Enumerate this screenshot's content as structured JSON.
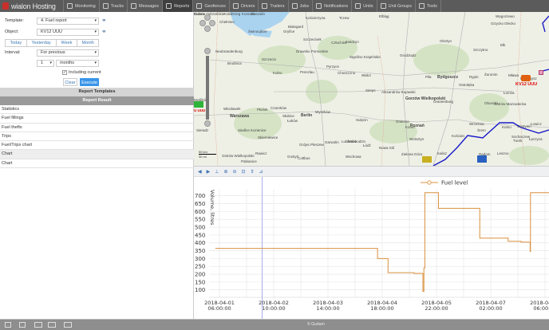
{
  "app": {
    "logo": "wialon Hosting"
  },
  "nav": [
    {
      "label": "Monitoring",
      "icon": "globe-icon"
    },
    {
      "label": "Tracks",
      "icon": "tracks-icon"
    },
    {
      "label": "Messages",
      "icon": "messages-icon"
    },
    {
      "label": "Reports",
      "icon": "reports-icon",
      "active": true
    },
    {
      "label": "Geofences",
      "icon": "geofences-icon"
    },
    {
      "label": "Drivers",
      "icon": "drivers-icon"
    },
    {
      "label": "Trailers",
      "icon": "trailers-icon"
    },
    {
      "label": "Jobs",
      "icon": "jobs-icon"
    },
    {
      "label": "Notifications",
      "icon": "notifications-icon"
    },
    {
      "label": "Units",
      "icon": "units-icon"
    },
    {
      "label": "Unit Groups",
      "icon": "unit-groups-icon"
    },
    {
      "label": "Tools",
      "icon": "tools-icon"
    }
  ],
  "form": {
    "template_label": "Template:",
    "template_value": "4. Fuel report",
    "object_label": "Object:",
    "object_value": "KV12 UUU",
    "quick": [
      "Today",
      "Yesterday",
      "Week",
      "Month"
    ],
    "interval_label": "Interval:",
    "interval_value": "For previous",
    "count_value": "1",
    "unit_value": "months",
    "including_current": "Including current",
    "including_checked": true,
    "clear": "Clear",
    "execute": "Execute"
  },
  "panels": {
    "templates": "Report Templates",
    "result": "Report Result"
  },
  "results": [
    {
      "label": "Statistics"
    },
    {
      "label": "Fuel fillings"
    },
    {
      "label": "Fuel thefts"
    },
    {
      "label": "Trips"
    },
    {
      "label": "Fuel/Trips chart"
    },
    {
      "label": "Chart",
      "selected": true
    },
    {
      "label": "Chart"
    }
  ],
  "map": {
    "cities": [
      "Kołobrzeg",
      "Koszalin",
      "Koszalin",
      "Kościerzyna",
      "Tczew",
      "Elbląg",
      "Węgorzewo",
      "Chełmiec",
      "Świnoujście",
      "Białogard",
      "Gryfice",
      "Szczecinek",
      "Człuchów",
      "Kwidzyn",
      "Olsztyn",
      "Gizycko",
      "Olecko",
      "Neubrandenburg",
      "Drawsko Pomorskie",
      "Sępólno Krajeńskie",
      "Grudziądz",
      "Szczytno",
      "Ełk",
      "Szczecin",
      "Brodnica",
      "Kolno",
      "Prenzlau",
      "Pyrzyce",
      "Choszczno",
      "Wałcz",
      "Piła",
      "Bydgoszcz",
      "Rypin",
      "Żuromin",
      "Mława",
      "Przasnysz",
      "Ostrołęka",
      "Łomża",
      "Myślibórz",
      "Czarnków",
      "Alexandrów Kujawski",
      "Sierpc",
      "Ostrów Mazowiecka",
      "Oranienburg",
      "Gorzów Wielkopolski",
      "Oborniki",
      "Włocławek",
      "Płońsk",
      "Wyszków",
      "Berlin",
      "Słubice",
      "Sulęcin",
      "Gniezno",
      "Poznań",
      "Września",
      "Konin",
      "Kutno",
      "Gostynin",
      "Łowicz",
      "Sochaczew",
      "Warszawa",
      "Siedlce",
      "Łuków",
      "Świebodzin",
      "Wolsztyn",
      "Kościan",
      "Śrem",
      "Turek",
      "Łęczyca",
      "Skierniewice",
      "Grójec",
      "Garwolin",
      "Lubartów",
      "Zielona Góra",
      "Leszno",
      "Pleszew",
      "Łódź",
      "Kalisz",
      "Radom",
      "Nowa Sól",
      "Wschowa",
      "Gostyń",
      "Rawicz",
      "Ostrów Wielkopolski",
      "Sieradz",
      "Pabianice",
      "Kozienice",
      "Cottbus",
      "Luckenwalde",
      "Guben",
      "Krosno Odrzańskie"
    ],
    "vehicle_label": "KV12 UUU",
    "vehicle_left_label": "U UUU",
    "scale_km": "50 km",
    "scale_mi": "30 mi",
    "route_color": "#1a1ac8"
  },
  "chart_toolbar": [
    "prev-icon",
    "next-icon",
    "zoom-y-icon",
    "zoom-in-icon",
    "zoom-out-icon",
    "zoom-reset-icon",
    "cursor-icon",
    "settings-icon"
  ],
  "chart_data": {
    "type": "line",
    "ylabel": "Volume, litres",
    "legend": "Fuel level",
    "legend_position": "top",
    "color": "#d9903e",
    "grid": true,
    "ylim": [
      60,
      760
    ],
    "xlim": [
      "2018-04-01 04:00",
      "2018-04-08 08:00"
    ],
    "yticks": [
      100,
      150,
      200,
      250,
      300,
      350,
      400,
      450,
      500,
      550,
      600,
      650,
      700
    ],
    "xticks": [
      {
        "date": "2018-04-01",
        "time": "06:00:00",
        "at": "2018-04-01 06:00"
      },
      {
        "date": "2018-04-02",
        "time": "10:00:00",
        "at": "2018-04-02 10:00"
      },
      {
        "date": "2018-04-03",
        "time": "14:00:00",
        "at": "2018-04-03 14:00"
      },
      {
        "date": "2018-04-04",
        "time": "18:00:00",
        "at": "2018-04-04 18:00"
      },
      {
        "date": "2018-04-05",
        "time": "22:00:00",
        "at": "2018-04-05 22:00"
      },
      {
        "date": "2018-04-07",
        "time": "02:00:00",
        "at": "2018-04-07 02:00"
      },
      {
        "date": "2018-04-08",
        "time": "06:00:00",
        "at": "2018-04-08 06:00"
      }
    ],
    "cursor": "2018-04-02 04:00",
    "points": [
      [
        "2018-04-01 04:00",
        365
      ],
      [
        "2018-04-04 15:30",
        365
      ],
      [
        "2018-04-04 15:35",
        300
      ],
      [
        "2018-04-04 17:00",
        300
      ],
      [
        "2018-04-04 21:00",
        210
      ],
      [
        "2018-04-05 10:25",
        205
      ],
      [
        "2018-04-05 15:00",
        90
      ],
      [
        "2018-04-05 15:30",
        240
      ],
      [
        "2018-04-05 16:00",
        720
      ],
      [
        "2018-04-05 21:00",
        720
      ],
      [
        "2018-04-05 23:00",
        620
      ],
      [
        "2018-04-06 12:00",
        620
      ],
      [
        "2018-04-06 20:20",
        430
      ],
      [
        "2018-04-07 10:40",
        430
      ],
      [
        "2018-04-07 11:00",
        410
      ],
      [
        "2018-04-07 17:35",
        405
      ],
      [
        "2018-04-07 22:20",
        345
      ],
      [
        "2018-04-07 22:30",
        720
      ],
      [
        "2018-04-08 08:00",
        720
      ]
    ]
  },
  "footer": {
    "copyright": "© Gurtam"
  }
}
